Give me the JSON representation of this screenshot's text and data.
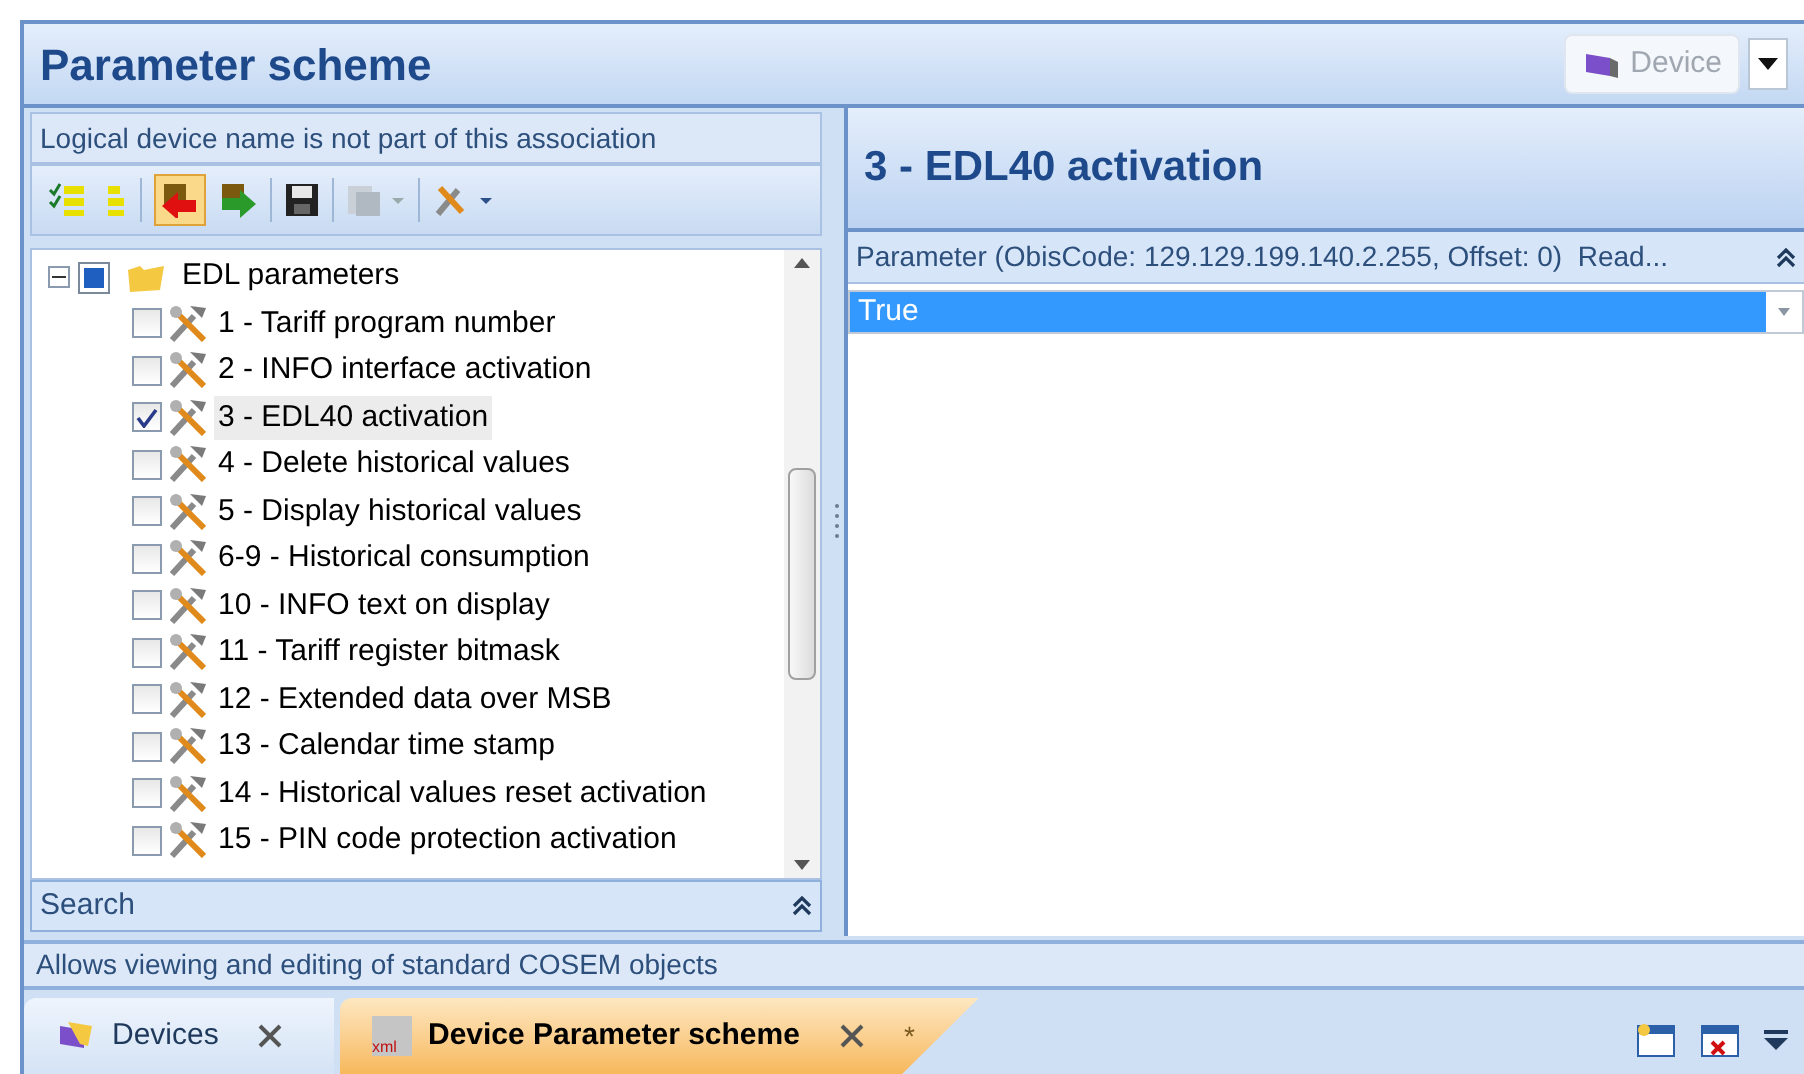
{
  "window": {
    "title": "Parameter scheme"
  },
  "device_button": {
    "label": "Device",
    "disabled": true
  },
  "left_panel": {
    "notice": "Logical device name is not part of this association",
    "tree": {
      "label": "EDL parameters",
      "expanded": true,
      "children": [
        {
          "label": "1 - Tariff program number",
          "checked": false,
          "selected": false
        },
        {
          "label": "2 - INFO interface activation",
          "checked": false,
          "selected": false
        },
        {
          "label": "3 - EDL40 activation",
          "checked": true,
          "selected": true
        },
        {
          "label": "4 - Delete historical values",
          "checked": false,
          "selected": false
        },
        {
          "label": "5 - Display historical values",
          "checked": false,
          "selected": false
        },
        {
          "label": "6-9 - Historical consumption",
          "checked": false,
          "selected": false
        },
        {
          "label": "10 - INFO text on display",
          "checked": false,
          "selected": false
        },
        {
          "label": "11 - Tariff register bitmask",
          "checked": false,
          "selected": false
        },
        {
          "label": "12 - Extended data over MSB",
          "checked": false,
          "selected": false
        },
        {
          "label": "13 - Calendar time stamp",
          "checked": false,
          "selected": false
        },
        {
          "label": "14 - Historical values reset activation",
          "checked": false,
          "selected": false
        },
        {
          "label": "15 - PIN code protection activation",
          "checked": false,
          "selected": false
        }
      ]
    },
    "search_section": {
      "label": "Search",
      "expanded": false
    }
  },
  "right_panel": {
    "title": "3 - EDL40 activation",
    "parameter_header": "Parameter (ObisCode: 129.129.199.140.2.255, Offset: 0)  Read...",
    "value": "True"
  },
  "status_bar": "Allows viewing and editing of standard COSEM objects",
  "tabs": [
    {
      "label": "Devices",
      "selected": false
    },
    {
      "label": "Device Parameter scheme",
      "selected": true,
      "icon_label": "xml",
      "modified_mark": "*"
    }
  ]
}
